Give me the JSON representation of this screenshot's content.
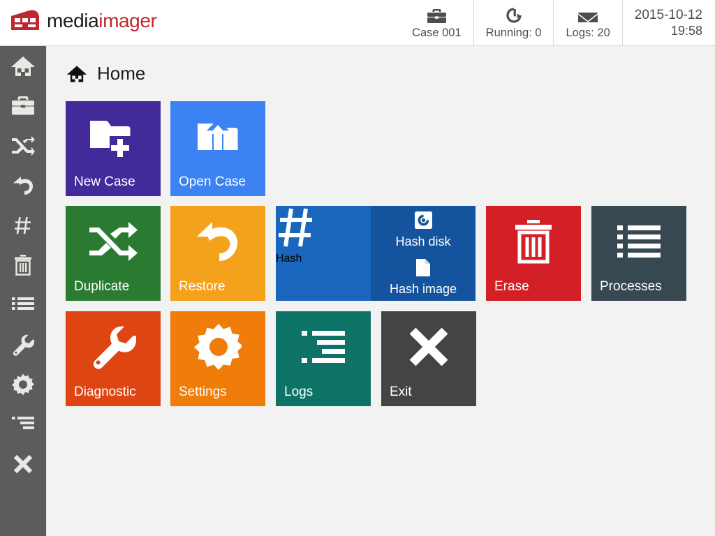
{
  "header": {
    "logo": {
      "mark_name": "mediaimager-logo-mark",
      "text_primary": "media",
      "text_accent": "imager",
      "brand_red": "#c0272d"
    },
    "status": [
      {
        "icon": "briefcase-icon",
        "label": "Case 001"
      },
      {
        "icon": "running-process-icon",
        "label": "Running: 0"
      },
      {
        "icon": "envelope-icon",
        "label": "Logs: 20"
      }
    ],
    "datetime": {
      "date": "2015-10-12",
      "time": "19:58"
    }
  },
  "sidebar": {
    "background": "#5c5c5c",
    "items": [
      {
        "icon": "home-icon",
        "name": "sidebar-item-home"
      },
      {
        "icon": "briefcase-icon",
        "name": "sidebar-item-case"
      },
      {
        "icon": "shuffle-icon",
        "name": "sidebar-item-duplicate"
      },
      {
        "icon": "undo-arrow-icon",
        "name": "sidebar-item-restore"
      },
      {
        "icon": "hash-icon",
        "name": "sidebar-item-hash"
      },
      {
        "icon": "trash-icon",
        "name": "sidebar-item-erase"
      },
      {
        "icon": "list-icon",
        "name": "sidebar-item-processes"
      },
      {
        "icon": "wrench-icon",
        "name": "sidebar-item-diagnostic"
      },
      {
        "icon": "gear-icon",
        "name": "sidebar-item-settings"
      },
      {
        "icon": "logs-icon",
        "name": "sidebar-item-logs"
      },
      {
        "icon": "close-x-icon",
        "name": "sidebar-item-exit"
      }
    ]
  },
  "page": {
    "title": "Home",
    "title_icon": "home-icon"
  },
  "tiles": {
    "new_case": {
      "label": "New Case",
      "color": "#432a9a",
      "icon": "folder-plus-icon"
    },
    "open_case": {
      "label": "Open Case",
      "color": "#3d82f2",
      "icon": "folder-upload-icon"
    },
    "duplicate": {
      "label": "Duplicate",
      "color": "#2b7a32",
      "icon": "shuffle-icon"
    },
    "restore": {
      "label": "Restore",
      "color": "#f4a11c",
      "icon": "undo-arrow-icon"
    },
    "hash": {
      "label": "Hash",
      "color": "#1b66bd",
      "icon": "hash-icon"
    },
    "hash_disk": {
      "label": "Hash disk",
      "color": "#14549f",
      "icon": "disk-icon"
    },
    "hash_image": {
      "label": "Hash image",
      "color": "#14549f",
      "icon": "file-icon"
    },
    "erase": {
      "label": "Erase",
      "color": "#d32027",
      "icon": "trash-icon"
    },
    "processes": {
      "label": "Processes",
      "color": "#374851",
      "icon": "list-icon"
    },
    "diagnostic": {
      "label": "Diagnostic",
      "color": "#df4413",
      "icon": "wrench-icon"
    },
    "settings": {
      "label": "Settings",
      "color": "#f07c0a",
      "icon": "gear-icon"
    },
    "logs": {
      "label": "Logs",
      "color": "#0e7367",
      "icon": "logs-icon"
    },
    "exit": {
      "label": "Exit",
      "color": "#444444",
      "icon": "close-x-icon"
    }
  }
}
